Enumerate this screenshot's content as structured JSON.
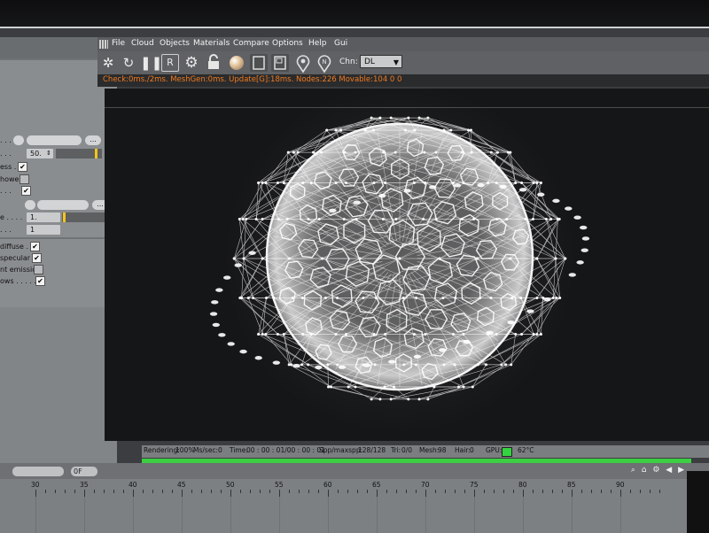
{
  "menu": {
    "items": [
      "File",
      "Cloud",
      "Objects",
      "Materials",
      "Compare",
      "Options",
      "Help",
      "Gui"
    ]
  },
  "toolbar": {
    "icons": [
      "layout-icon",
      "refresh-icon",
      "pause-icon",
      "reset-icon",
      "gear-icon",
      "lock-icon",
      "material-sphere-icon",
      "region-icon",
      "frame-icon",
      "pick-marker-icon",
      "nav-marker-icon"
    ],
    "channel_label": "Chn:",
    "channel_value": "DL"
  },
  "stats_line": "Check:0ms./2ms. MeshGen:0ms. Update[G]:18ms. Nodes:226 Movable:104  0 0",
  "left_panel": {
    "value_50": "50.",
    "value_1a": "1.",
    "value_1b": "1",
    "label_less": "ess . .",
    "label_hower": "hower",
    "label_diffuse": "diffuse . .",
    "label_specular": "specular . .",
    "label_emission": "nt emission",
    "label_ows": "ows . . . . . .",
    "label_dots1": ". . .",
    "label_dots2": ". . .",
    "label_dots3": "e . . . .",
    "btn_dots": "...",
    "arrows": "⇕"
  },
  "render_status": {
    "rendering_label": "Rendering:",
    "rendering_value": "100%",
    "ms_label": "Ms/sec:",
    "ms_value": "0",
    "time_label": "Time:",
    "time_value": "00 : 00 : 01/00 : 00 : 01",
    "spp_label": "Spp/maxspp:",
    "spp_value": "128/128",
    "tri_label": "Tri:",
    "tri_value": "0/0",
    "mesh_label": "Mesh:",
    "mesh_value": "98",
    "hair_label": "Hair:",
    "hair_value": "0",
    "gpu_label": "GPU:",
    "temp": "62°C",
    "progress": 1.0
  },
  "timeline": {
    "field_a": "",
    "field_b": "0F",
    "icons": "⌕ ⌂ ⚙ ◀ ▶",
    "ruler_labels": [
      "30",
      "35",
      "40",
      "45",
      "50",
      "55",
      "60",
      "65",
      "70",
      "75",
      "80",
      "85",
      "90"
    ]
  },
  "colors": {
    "stats_text": "#f07a1e",
    "progress_green": "#3ccf43",
    "panel_gray": "#8a8d90",
    "viewport_bg": "#151617"
  }
}
